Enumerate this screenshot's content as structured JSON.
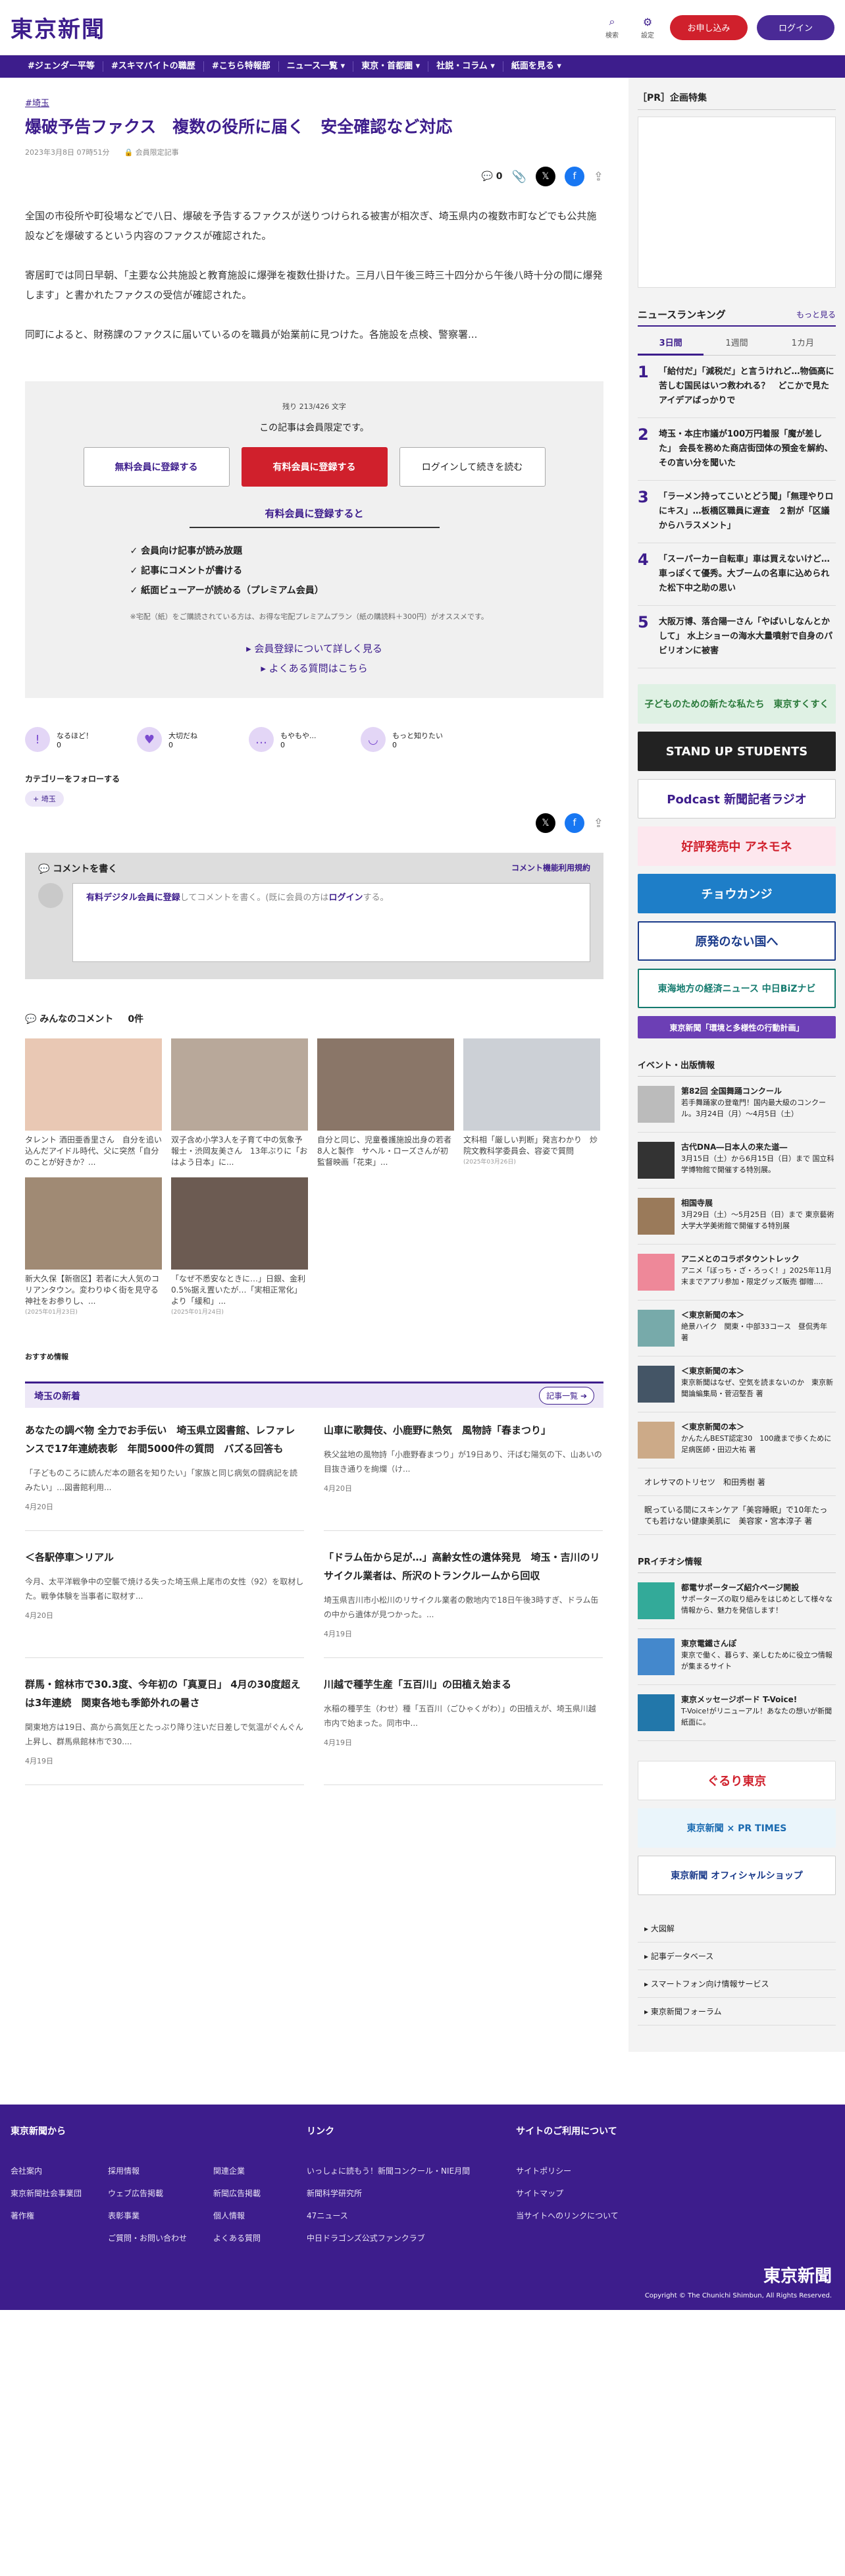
{
  "header": {
    "logo": "東京新聞",
    "search": "検索",
    "settings": "設定",
    "register": "お申し込み",
    "login": "ログイン"
  },
  "nav": [
    "#ジェンダー平等",
    "#スキマバイトの職歴",
    "#こちら特報部",
    "ニュース一覧 ▾",
    "東京・首都圏 ▾",
    "社説・コラム ▾",
    "紙面を見る ▾"
  ],
  "article": {
    "tag": "#埼玉",
    "title": "爆破予告ファクス　複数の役所に届く　安全確認など対応",
    "date": "2023年3月8日 07時51分",
    "member": "会員限定記事",
    "comment_count": "0",
    "p1": "全国の市役所や町役場などで八日、爆破を予告するファクスが送りつけられる被害が相次ぎ、埼玉県内の複数市町などでも公共施設などを爆破するという内容のファクスが確認された。",
    "p2": "寄居町では同日早朝、「主要な公共施設と教育施設に爆弾を複数仕掛けた。三月八日午後三時三十四分から午後八時十分の間に爆発します」と書かれたファクスの受信が確認された。",
    "p3": "同町によると、財務課のファクスに届いているのを職員が始業前に見つけた。各施設を点検、警察署..."
  },
  "paywall": {
    "remaining": "残り 213/426 文字",
    "limited": "この記事は会員限定です。",
    "free": "無料会員に登録する",
    "paid": "有料会員に登録する",
    "login": "ログインして続きを読む",
    "perks_title": "有料会員に登録すると",
    "perks": [
      "会員向け記事が読み放題",
      "記事にコメントが書ける",
      "紙面ビューアーが読める（プレミアム会員）"
    ],
    "note": "※宅配（紙）をご購読されている方は、お得な宅配プレミアムプラン（紙の購読料＋300円）がオススメです。",
    "link1": "会員登録について詳しく見る",
    "link2": "よくある質問はこちら"
  },
  "reactions": [
    {
      "label": "なるほど！",
      "count": "0"
    },
    {
      "label": "大切だね",
      "count": "0"
    },
    {
      "label": "もやもや...",
      "count": "0"
    },
    {
      "label": "もっと知りたい",
      "count": "0"
    }
  ],
  "follow": {
    "title": "カテゴリーをフォローする",
    "tag": "埼玉"
  },
  "comment": {
    "title": "コメントを書く",
    "rules": "コメント機能利用規約",
    "cta": "有料デジタル会員に登録",
    "rest": "してコメントを書く。(既に会員の方は",
    "login": "ログイン",
    "end": "する。"
  },
  "all_comments": {
    "title": "みんなのコメント",
    "count": "0件"
  },
  "cards": [
    {
      "text": "タレント 酒田亜香里さん　自分を追い込んだアイドル時代、父に突然「自分のことが好きか？..."
    },
    {
      "text": "双子含め小学3人を子育て中の気象予報士・渋岡友美さん　13年ぶりに「おはよう日本」に..."
    },
    {
      "text": "自分と同じ、児童養護施設出身の若者8人と製作　サヘル・ローズさんが初監督映画「花束」..."
    },
    {
      "text": "文科相「厳しい判断」発言わかり　炒院文教科学委員会、容姿で質問",
      "date": "(2025年03月26日)"
    },
    {
      "text": "新大久保【新宿区】若者に大人気のコリアンタウン。変わりゆく街を見守る神社をお参りし、...",
      "date": "(2025年01月23日)"
    },
    {
      "text": "「なぜ不悉安なときに…」日銀、金利0.5%据え置いたが…「実相正常化」より「緩和」...",
      "date": "(2025年01月24日)"
    }
  ],
  "recommend": "おすすめ情報",
  "section": {
    "title": "埼玉の新着",
    "more": "記事一覧"
  },
  "articles": [
    {
      "title": "あなたの調べ物 全力でお手伝い　埼玉県立図書館、レファレンスで17年連続表彰　年間5000件の質問　バズる回答も",
      "text": "「子どものころに読んだ本の題名を知りたい」「家族と同じ病気の闘病記を読みたい」…図書館利用...",
      "date": "4月20日"
    },
    {
      "title": "山車に歌舞伎、小鹿野に熱気　風物詩「春まつり」",
      "text": "秩父盆地の風物詩「小鹿野春まつり」が19日あり、汗ばむ陽気の下、山あいの目抜き通りを絢爛（け...",
      "date": "4月20日"
    },
    {
      "title": "＜各駅停車＞リアル",
      "text": "今月、太平洋戦争中の空襲で焼ける失った埼玉県上尾市の女性（92）を取材した。戦争体験を当事者に取材す...",
      "date": "4月20日"
    },
    {
      "title": "「ドラム缶から足が…」高齢女性の遺体発見　埼玉・吉川のリサイクル業者は、所沢のトランクルームから回収",
      "text": "埼玉県吉川市小松川のリサイクル業者の敷地内で18日午後3時すぎ、ドラム缶の中から遺体が見つかった。...",
      "date": "4月19日"
    },
    {
      "title": "群馬・館林市で30.3度、今年初の「真夏日」 4月の30度超えは3年連続　関東各地も季節外れの暑さ",
      "text": "関東地方は19日、高から高気圧とたっぷり降り注いだ日差しで気温がぐんぐん上昇し、群馬県館林市で30....",
      "date": "4月19日"
    },
    {
      "title": "川越で種芋生産「五百川」の田植え始まる",
      "text": "水稲の種芋生（わせ）種「五百川（ごひゃくがわ）」の田植えが、埼玉県川越市内で始まった。同市中...",
      "date": "4月19日"
    }
  ],
  "side": {
    "pr": "［PR］企画特集",
    "ranking": "ニュースランキング",
    "more": "もっと見る",
    "tabs": [
      "3日間",
      "1週間",
      "1カ月"
    ],
    "items": [
      "「給付だ」「減税だ」と言うけれど…物価高に苦しむ国民はいつ救われる？　どこかで見たアイデアばっかりで",
      "埼玉・本庄市議が100万円着服「魔が差した」 会長を務めた商店街団体の預金を解約、その言い分を聞いた",
      "「ラーメン持ってこいとどう聞」「無理やりロにキス」…板橋区職員に遅査　２割が「区議からハラスメント」",
      "「スーパーカー自転車」車は買えないけど…車っぽくて優秀。大ブームの名車に込められた松下中之助の思い",
      "大阪万博、落合陽一さん「やばいしなんとかして」 水上ショーの海水大量噴射で自身のパビリオンに被害"
    ],
    "banners": [
      "子どものための新たな私たち　東京すくすく",
      "STAND UP STUDENTS",
      "Podcast 新聞記者ラジオ",
      "好評発売中 アネモネ",
      "チョウカンジ",
      "原発のない国へ",
      "東海地方の経済ニュース 中日BiZナビ",
      "東京新聞「環境と多様性の行動計画」"
    ],
    "events_title": "イベント・出版情報",
    "events": [
      {
        "t": "第82回 全国舞踊コンクール",
        "s": "若手舞踊家の登竜門！国内最大級のコンクール。3月24日（月）～4月5日（土）"
      },
      {
        "t": "古代DNA―日本人の来た道―",
        "s": "3月15日（土）から6月15日（日）まで 国立科学博物館で開催する特別展。"
      },
      {
        "t": "相国寺展",
        "s": "3月29日（土）～5月25日（日）まで 東京藝術大学大学美術館で開催する特別展"
      },
      {
        "t": "アニメとのコラボタウントレック",
        "s": "アニメ「ぼっち・ざ・ろっく！」2025年11月末までアプリ参加・限定グッズ販売 御贈...."
      },
      {
        "t": "＜東京新聞の本＞",
        "s": "絶景ハイク　関東・中部33コース　昼侃秀年 著"
      },
      {
        "t": "＜東京新聞の本＞",
        "s": "東京新聞はなぜ、空気を読まないのか　東京新聞論編集局・菅沼堅吾 著"
      },
      {
        "t": "＜東京新聞の本＞",
        "s": "かんたんBEST認定30　100歳まで歩くために　足病医師・田辺大祐 著"
      }
    ],
    "book1": "オレサマのトリセツ　和田秀樹 著",
    "book2": "眠っている間にスキンケア「美容睡眠」で10年たっても若けない健康美肌に　美容家・宮本淳子 著",
    "pr_info": "PRイチオシ情報",
    "pr_items": [
      {
        "t": "都電サポーターズ紹介ページ開設",
        "s": "サポーターズの取り組みをはじめとして様々な情報から、魅力を発信します！"
      },
      {
        "t": "東京電鐵さんぽ",
        "s": "東京で働く、暮らす、楽しむために役立つ情報が集まるサイト"
      },
      {
        "t": "東京メッセージボード T-Voice!",
        "s": "T-Voice!がリニューアル！あなたの想いが新聞紙面に。"
      }
    ],
    "logos": [
      "ぐるり東京",
      "東京新聞 × PR TIMES",
      "東京新聞 オフィシャルショップ"
    ],
    "links": [
      "大図解",
      "記事データベース",
      "スマートフォン向け情報サービス",
      "東京新聞フォーラム"
    ]
  },
  "footer": {
    "h1": "東京新聞から",
    "col1": [
      "会社案内",
      "東京新聞社会事業団",
      "著作権"
    ],
    "col2": [
      "採用情報",
      "ウェブ広告掲載",
      "表彰事業",
      "ご質問・お問い合わせ"
    ],
    "col3": [
      "関連企業",
      "新聞広告掲載",
      "個人情報",
      "よくある質問"
    ],
    "h2": "リンク",
    "col4": [
      "いっしょに読もう！新聞コンクール・NIE月間",
      "新聞科学研究所",
      "47ニュース",
      "中日ドラゴンズ公式ファンクラブ"
    ],
    "h3": "サイトのご利用について",
    "col5": [
      "サイトポリシー",
      "サイトマップ",
      "当サイトへのリンクについて"
    ],
    "logo": "東京新聞",
    "copy": "Copyright © The Chunichi Shimbun, All Rights Reserved."
  }
}
